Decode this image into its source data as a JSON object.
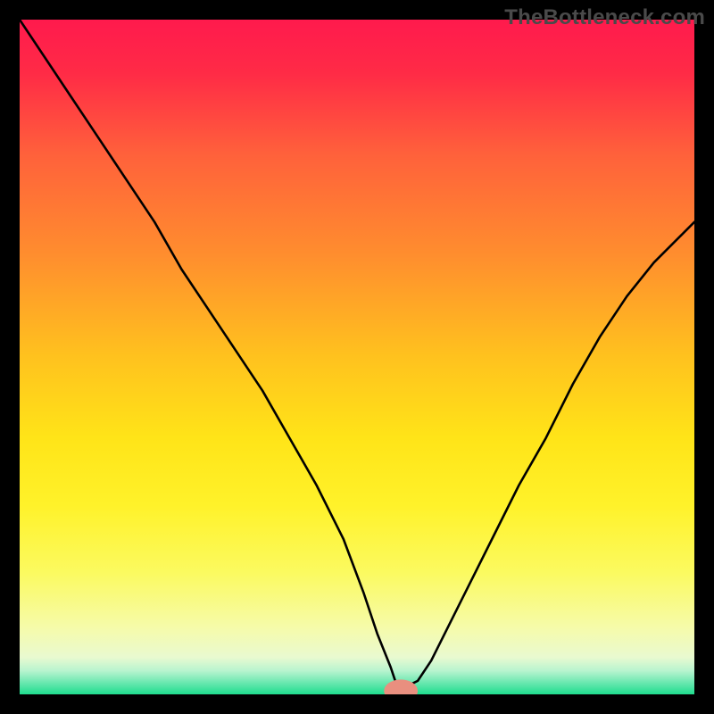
{
  "watermark": "TheBottleneck.com",
  "chart_data": {
    "type": "line",
    "title": "",
    "xlabel": "",
    "ylabel": "",
    "xlim": [
      0,
      100
    ],
    "ylim": [
      0,
      100
    ],
    "grid": false,
    "legend": false,
    "background_gradient": {
      "stops": [
        {
          "offset": 0.0,
          "color": "#ff1a4d"
        },
        {
          "offset": 0.08,
          "color": "#ff2b46"
        },
        {
          "offset": 0.2,
          "color": "#ff613b"
        },
        {
          "offset": 0.35,
          "color": "#ff8e2e"
        },
        {
          "offset": 0.5,
          "color": "#ffc21e"
        },
        {
          "offset": 0.62,
          "color": "#ffe418"
        },
        {
          "offset": 0.72,
          "color": "#fff22a"
        },
        {
          "offset": 0.82,
          "color": "#fbfa60"
        },
        {
          "offset": 0.9,
          "color": "#f6fba9"
        },
        {
          "offset": 0.945,
          "color": "#e9fad0"
        },
        {
          "offset": 0.965,
          "color": "#b8f4cf"
        },
        {
          "offset": 0.982,
          "color": "#6de8b1"
        },
        {
          "offset": 1.0,
          "color": "#1fdd8e"
        }
      ]
    },
    "series": [
      {
        "name": "curve",
        "color": "#000000",
        "stroke_width": 2.6,
        "x": [
          0,
          4,
          8,
          12,
          16,
          20,
          24,
          28,
          32,
          36,
          40,
          44,
          48,
          51,
          53,
          55,
          56,
          57,
          59,
          61,
          63,
          66,
          70,
          74,
          78,
          82,
          86,
          90,
          94,
          98,
          100
        ],
        "y": [
          100,
          94,
          88,
          82,
          76,
          70,
          63,
          57,
          51,
          45,
          38,
          31,
          23,
          15,
          9,
          4,
          1,
          1,
          2,
          5,
          9,
          15,
          23,
          31,
          38,
          46,
          53,
          59,
          64,
          68,
          70
        ]
      }
    ],
    "marker": {
      "name": "bottleneck-point",
      "x": 56.5,
      "y": 0.5,
      "rx": 2.5,
      "ry": 1.7,
      "color": "#e98f7f"
    }
  }
}
